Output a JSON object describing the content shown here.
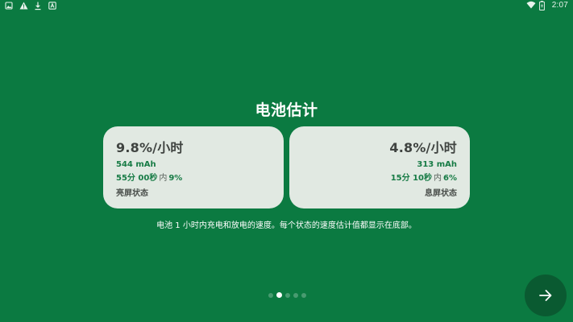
{
  "status_bar": {
    "time": "2:07",
    "left_icons": [
      "photo-icon",
      "warning-icon",
      "download-icon",
      "app-notification-icon"
    ],
    "right_icons": [
      "wifi-icon",
      "battery-icon"
    ]
  },
  "title": "电池估计",
  "cards": [
    {
      "rate": "9.8%/小时",
      "mah": "544 mAh",
      "duration": "55分 00秒",
      "within": "内",
      "percent": "9%",
      "state": "亮屏状态"
    },
    {
      "rate": "4.8%/小时",
      "mah": "313 mAh",
      "duration": "15分 10秒",
      "within": "内",
      "percent": "6%",
      "state": "息屏状态"
    }
  ],
  "description": "电池 1 小时内充电和放电的速度。每个状态的速度估计值都显示在底部。",
  "pager": {
    "count": 5,
    "active_index": 1
  },
  "next_button_icon": "arrow-right-icon",
  "colors": {
    "background": "#0b7a41",
    "card": "#e1e9e2",
    "accent_text": "#177b45",
    "fab": "#0a5a31"
  }
}
